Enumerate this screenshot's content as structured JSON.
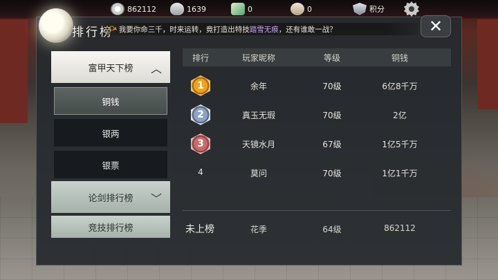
{
  "resources": [
    {
      "icon": "film-reel-icon",
      "value": "862112"
    },
    {
      "icon": "silver-bowl-icon",
      "value": "1639"
    },
    {
      "icon": "jade-ticket-icon",
      "value": "0"
    },
    {
      "icon": "pot-icon",
      "value": "0"
    },
    {
      "icon": "shield-icon",
      "value": "积分"
    }
  ],
  "title": "排行榜",
  "ticker": {
    "before": "我要你命三千，时来运转，竟打造出特技",
    "highlight": "踏雪无痕",
    "after": "，还有谁敢一战？"
  },
  "close_label": "✕",
  "nav": {
    "active_category": "富甲天下榜",
    "subitems": [
      "铜钱",
      "银两",
      "银票"
    ],
    "selected_subitem": "铜钱",
    "other_categories": [
      "论剑排行榜",
      "竞技排行榜"
    ]
  },
  "table": {
    "headers": [
      "排行",
      "玩家昵称",
      "等级",
      "铜钱"
    ],
    "rows": [
      {
        "rank": "1",
        "badge": "gold",
        "name": "余年",
        "level": "70级",
        "money": "6亿8千万"
      },
      {
        "rank": "2",
        "badge": "silver",
        "name": "真玉无瑕",
        "level": "70级",
        "money": "2亿"
      },
      {
        "rank": "3",
        "badge": "bronze",
        "name": "天镜水月",
        "level": "67级",
        "money": "1亿5千万"
      },
      {
        "rank": "4",
        "badge": "",
        "name": "莫问",
        "level": "70级",
        "money": "1亿1千万"
      }
    ]
  },
  "mine": {
    "rank_label": "未上榜",
    "name": "花季",
    "level": "64级",
    "money": "862112"
  },
  "colors": {
    "ticker_highlight": "#c9a0f0",
    "panel_bg": "#262a2e"
  }
}
